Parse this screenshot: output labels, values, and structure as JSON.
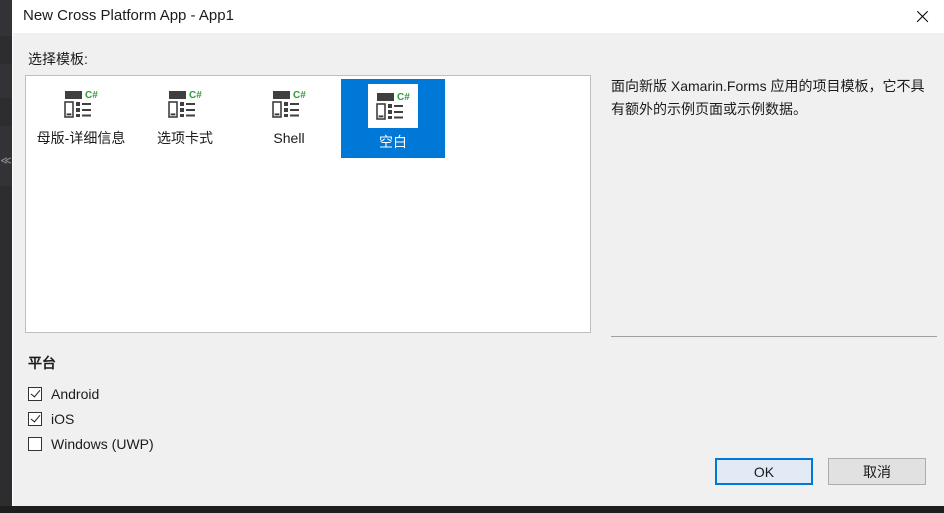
{
  "window": {
    "title": "New Cross Platform App - App1",
    "close_icon": "close-icon"
  },
  "main": {
    "select_template_label": "选择模板:",
    "templates": [
      {
        "label": "母版-详细信息",
        "icon": "csharp-app-template-icon",
        "selected": false
      },
      {
        "label": "选项卡式",
        "icon": "csharp-app-template-icon",
        "selected": false
      },
      {
        "label": "Shell",
        "icon": "csharp-app-template-icon",
        "selected": false
      },
      {
        "label": "空白",
        "icon": "csharp-app-template-icon",
        "selected": true
      }
    ],
    "description": "面向新版 Xamarin.Forms 应用的项目模板，它不具有额外的示例页面或示例数据。"
  },
  "platform": {
    "heading": "平台",
    "options": [
      {
        "label": "Android",
        "checked": true
      },
      {
        "label": "iOS",
        "checked": true
      },
      {
        "label": "Windows (UWP)",
        "checked": false
      }
    ]
  },
  "footer": {
    "ok_label": "OK",
    "cancel_label": "取消"
  },
  "colors": {
    "accent": "#0078d7",
    "dialog_bg": "#f0f0f0",
    "titlebar_bg": "#ffffff",
    "listbox_bg": "#ffffff",
    "text": "#1b1b1b",
    "csharp_green": "#2e9b3e",
    "icon_gray": "#3f3f3f"
  },
  "background": {
    "vs_glyph": "≪"
  }
}
